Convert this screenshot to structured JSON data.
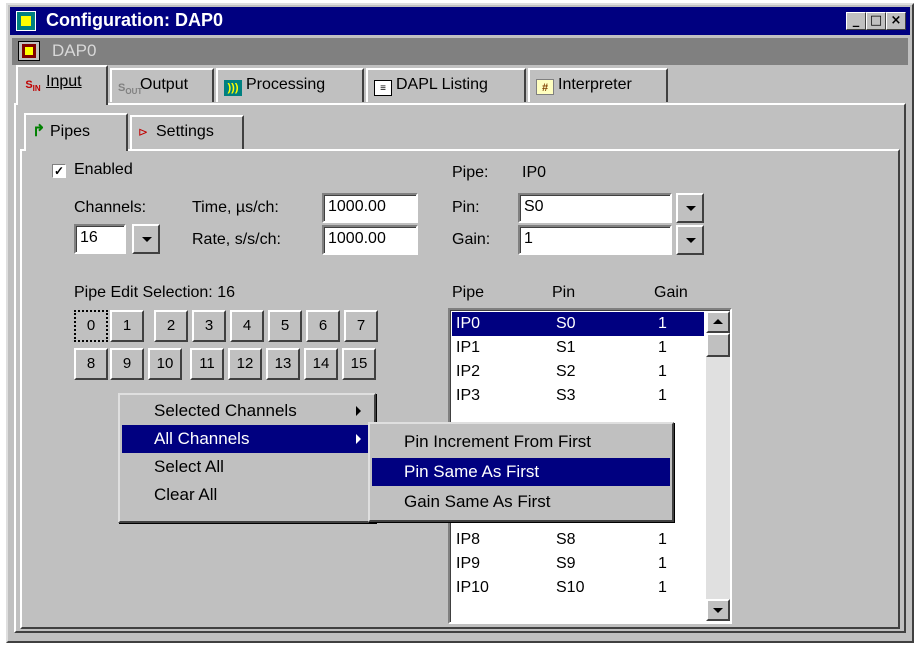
{
  "window": {
    "title": "Configuration: DAP0",
    "minimize": "_",
    "maximize": "□",
    "close": "×"
  },
  "subtitle": "DAP0",
  "tabs": [
    {
      "label": "Input",
      "icon": "input-icon",
      "active": true
    },
    {
      "label": "Output",
      "icon": "output-icon",
      "active": false
    },
    {
      "label": "Processing",
      "icon": "processing-icon",
      "active": false
    },
    {
      "label": "DAPL Listing",
      "icon": "listing-icon",
      "active": false
    },
    {
      "label": "Interpreter",
      "icon": "interpreter-icon",
      "active": false
    }
  ],
  "subtabs": [
    {
      "label": "Pipes",
      "icon": "pipe-icon",
      "active": true
    },
    {
      "label": "Settings",
      "icon": "settings-icon",
      "active": false
    }
  ],
  "enabled": {
    "label": "Enabled",
    "checked": true,
    "mark": "✓"
  },
  "channels": {
    "label": "Channels:",
    "value": "16"
  },
  "time": {
    "label": "Time, µs/ch:",
    "value": "1000.00"
  },
  "rate": {
    "label": "Rate, s/s/ch:",
    "value": "1000.00"
  },
  "pipe": {
    "label": "Pipe:",
    "value": "IP0"
  },
  "pin": {
    "label": "Pin:",
    "value": "S0"
  },
  "gain": {
    "label": "Gain:",
    "value": "1"
  },
  "pipe_edit": {
    "label": "Pipe Edit Selection: 16",
    "row1": [
      "0",
      "1",
      "2",
      "3",
      "4",
      "5",
      "6",
      "7"
    ],
    "row2": [
      "8",
      "9",
      "10",
      "11",
      "12",
      "13",
      "14",
      "15"
    ]
  },
  "list": {
    "headers": [
      "Pipe",
      "Pin",
      "Gain"
    ],
    "rows": [
      [
        "IP0",
        "S0",
        "1"
      ],
      [
        "IP1",
        "S1",
        "1"
      ],
      [
        "IP2",
        "S2",
        "1"
      ],
      [
        "IP3",
        "S3",
        "1"
      ],
      [
        "IP8",
        "S8",
        "1"
      ],
      [
        "IP9",
        "S9",
        "1"
      ],
      [
        "IP10",
        "S10",
        "1"
      ]
    ]
  },
  "context_menu": {
    "items": [
      "Selected Channels",
      "All Channels",
      "Select All",
      "Clear All"
    ]
  },
  "submenu": {
    "items": [
      "Pin Increment From First",
      "Pin Same As First",
      "Gain Same As First"
    ]
  },
  "colors": {
    "title_bar": "#000080",
    "selection": "#000080",
    "face": "#c0c0c0"
  }
}
